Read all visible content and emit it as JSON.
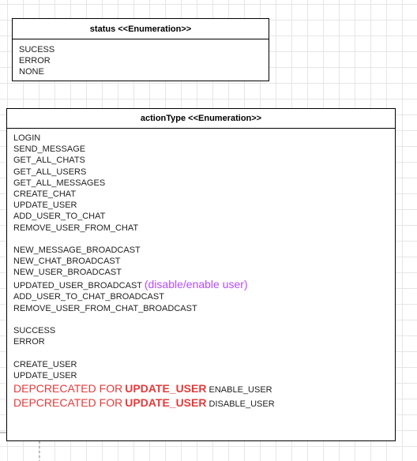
{
  "status_enum": {
    "title": "status <<Enumeration>>",
    "values": [
      "SUCESS",
      "ERROR",
      "NONE"
    ]
  },
  "action_enum": {
    "title": "actionType <<Enumeration>>",
    "group1": [
      "LOGIN",
      "SEND_MESSAGE",
      "GET_ALL_CHATS",
      "GET_ALL_USERS",
      "GET_ALL_MESSAGES",
      "CREATE_CHAT",
      "UPDATE_USER",
      "ADD_USER_TO_CHAT",
      "REMOVE_USER_FROM_CHAT"
    ],
    "group2a": [
      "NEW_MESSAGE_BROADCAST",
      "NEW_CHAT_BROADCAST",
      "NEW_USER_BROADCAST"
    ],
    "updated_user_broadcast": "UPDATED_USER_BROADCAST",
    "updated_user_note": "(disable/enable user)",
    "group2b": [
      "ADD_USER_TO_CHAT_BROADCAST",
      "REMOVE_USER_FROM_CHAT_BROADCAST"
    ],
    "group3": [
      "SUCCESS",
      "ERROR"
    ],
    "group4": [
      "CREATE_USER",
      "UPDATE_USER"
    ],
    "deprecated": [
      {
        "prefix": "DEPCRECATED FOR",
        "target": "UPDATE_USER",
        "value": "ENABLE_USER"
      },
      {
        "prefix": "DEPCRECATED FOR",
        "target": "UPDATE_USER",
        "value": "DISABLE_USER"
      }
    ]
  },
  "colors": {
    "note": "#b64bff",
    "deprecated": "#e63a3a",
    "grid": "#e6e6e6",
    "border": "#000000"
  }
}
